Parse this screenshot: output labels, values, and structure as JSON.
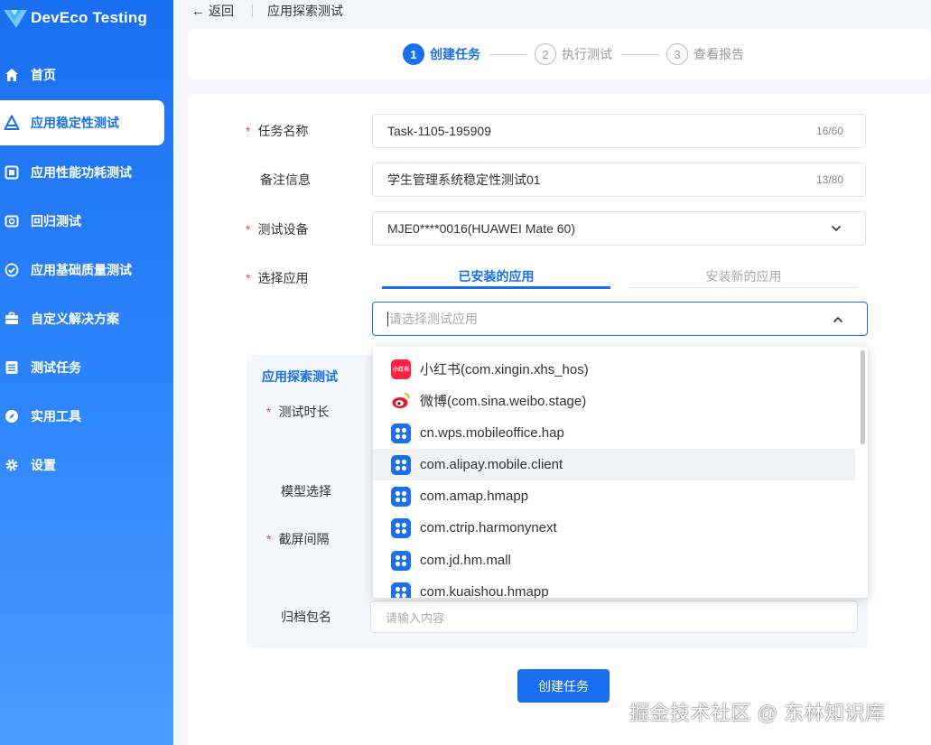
{
  "brand": {
    "name": "DevEco Testing"
  },
  "sidebar": {
    "items": [
      {
        "label": "首页",
        "icon": "home-icon"
      },
      {
        "label": "应用稳定性测试",
        "icon": "flask-icon",
        "active": true
      },
      {
        "label": "应用性能功耗测试",
        "icon": "performance-icon"
      },
      {
        "label": "回归测试",
        "icon": "regression-icon"
      },
      {
        "label": "应用基础质量测试",
        "icon": "check-circle-icon"
      },
      {
        "label": "自定义解决方案",
        "icon": "toolbox-icon"
      },
      {
        "label": "测试任务",
        "icon": "task-list-icon"
      },
      {
        "label": "实用工具",
        "icon": "compass-icon"
      },
      {
        "label": "设置",
        "icon": "gear-icon"
      }
    ]
  },
  "topbar": {
    "back_label": "返回",
    "page_title": "应用探索测试"
  },
  "steps": [
    {
      "num": "1",
      "label": "创建任务",
      "active": true
    },
    {
      "num": "2",
      "label": "执行测试",
      "active": false
    },
    {
      "num": "3",
      "label": "查看报告",
      "active": false
    }
  ],
  "form": {
    "task_name": {
      "label": "任务名称",
      "value": "Task-1105-195909",
      "counter": "16/60"
    },
    "remark": {
      "label": "备注信息",
      "value": "学生管理系统稳定性测试01",
      "counter": "13/80"
    },
    "device": {
      "label": "测试设备",
      "value": "MJE0****0016(HUAWEI Mate 60)"
    },
    "app": {
      "label": "选择应用",
      "tabs": [
        "已安装的应用",
        "安装新的应用"
      ],
      "placeholder": "请选择测试应用"
    },
    "sub_section": {
      "title": "应用探索测试",
      "duration_label": "测试时长",
      "model_label": "模型选择",
      "interval_label": "截屏间隔",
      "archive_label": "归档包名",
      "archive_placeholder": "请输入内容"
    },
    "submit_label": "创建任务"
  },
  "dropdown": {
    "items": [
      {
        "label": "小红书(com.xingin.xhs_hos)",
        "icon": "xiaohongshu-icon",
        "icon_text": "小红书"
      },
      {
        "label": "微博(com.sina.weibo.stage)",
        "icon": "weibo-icon"
      },
      {
        "label": "cn.wps.mobileoffice.hap",
        "icon": "app-grid-icon"
      },
      {
        "label": "com.alipay.mobile.client",
        "icon": "app-grid-icon",
        "hover": true
      },
      {
        "label": "com.amap.hmapp",
        "icon": "app-grid-icon"
      },
      {
        "label": "com.ctrip.harmonynext",
        "icon": "app-grid-icon"
      },
      {
        "label": "com.jd.hm.mall",
        "icon": "app-grid-icon"
      },
      {
        "label": "com.kuaishou.hmapp",
        "icon": "app-grid-icon"
      }
    ]
  },
  "watermark": "掘金技术社区 @ 东林知识库",
  "colors": {
    "accent": "#1a6ff0",
    "required": "#e5484d",
    "xiaohongshu": "#ff2442",
    "weibo": "#f5a623"
  }
}
